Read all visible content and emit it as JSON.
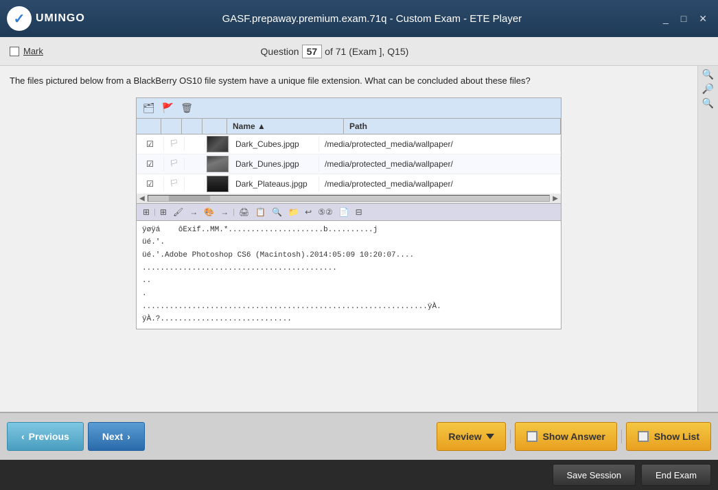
{
  "titleBar": {
    "title": "GASF.prepaway.premium.exam.71q - Custom Exam - ETE Player",
    "logoText": "UMINGO",
    "controls": {
      "minimize": "_",
      "maximize": "□",
      "close": "✕"
    }
  },
  "questionHeader": {
    "markLabel": "Mark",
    "questionLabel": "Question",
    "questionNumber": "57",
    "questionTotal": "of 71 (Exam ], Q15)"
  },
  "questionText": "The files pictured below from a BlackBerry OS10 file system have a unique file extension. What can be concluded about these files?",
  "fileBrowser": {
    "headers": {
      "name": "Name ▲",
      "path": "Path"
    },
    "files": [
      {
        "name": "Dark_Cubes.jpgp",
        "path": "/media/protected_media/wallpaper/",
        "thumbType": "cubes"
      },
      {
        "name": "Dark_Dunes.jpgp",
        "path": "/media/protected_media/wallpaper/",
        "thumbType": "dunes"
      },
      {
        "name": "Dark_Plateaus.jpgp",
        "path": "/media/protected_media/wallpaper/",
        "thumbType": "plateaus"
      }
    ],
    "hexContent": [
      "ÿøÿá    ôExif..MM.*.....................b..........j",
      "üé.'.",
      "üé.'.Adobe Photoshop CS6 (Macintosh).2014:05:09 10:20:07....",
      "...........................................",
      "..",
      ".",
      "...............................................................ÿÀ.",
      "ÿÀ.?............................."
    ]
  },
  "navbar": {
    "previousLabel": "Previous",
    "nextLabel": "Next",
    "reviewLabel": "Review",
    "showAnswerLabel": "Show Answer",
    "showListLabel": "Show List"
  },
  "actionBar": {
    "saveSessionLabel": "Save Session",
    "endExamLabel": "End Exam"
  }
}
